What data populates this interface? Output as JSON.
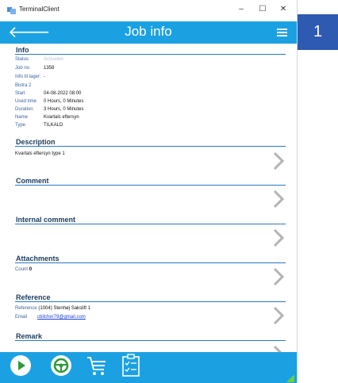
{
  "window": {
    "app_title": "TerminalClient",
    "minimize": "–",
    "maximize": "☐",
    "close": "✕"
  },
  "appbar": {
    "back": "🡐",
    "title": "Job info"
  },
  "info": {
    "heading": "Info",
    "fields": [
      {
        "label": "Status",
        "value": "Activated"
      },
      {
        "label": "Job no",
        "value": "1358"
      },
      {
        "label": "Info til lager:",
        "value": "-"
      },
      {
        "label": "Bistra 2",
        "value": ""
      },
      {
        "label": "Start",
        "value": "04-08-2022 08:00"
      },
      {
        "label": "Used time",
        "value": "0 Hours, 0 Minutes"
      },
      {
        "label": "Duration",
        "value": "3 Hours, 0 Minutes"
      },
      {
        "label": "Name",
        "value": "Kvartals eftersyn"
      },
      {
        "label": "Type",
        "value": "TILKALD"
      }
    ]
  },
  "description": {
    "heading": "Description",
    "text": "Kvartals eftersyn type 1"
  },
  "comment": {
    "heading": "Comment"
  },
  "internal_comment": {
    "heading": "Internal comment"
  },
  "attachments": {
    "heading": "Attachments",
    "count_label": "Count",
    "count_value": "0"
  },
  "reference": {
    "heading": "Reference",
    "ref_label": "Reference",
    "ref_value": "(1004) Stenhøj Sakslift 1",
    "email_label": "Email",
    "email_value": "cbilcher79@gmail.com"
  },
  "remark": {
    "heading": "Remark"
  },
  "badge": {
    "number": "1"
  },
  "colors": {
    "accent": "#1ba1e2",
    "badge": "#2e5ab1",
    "section_line": "#2a78c2"
  }
}
